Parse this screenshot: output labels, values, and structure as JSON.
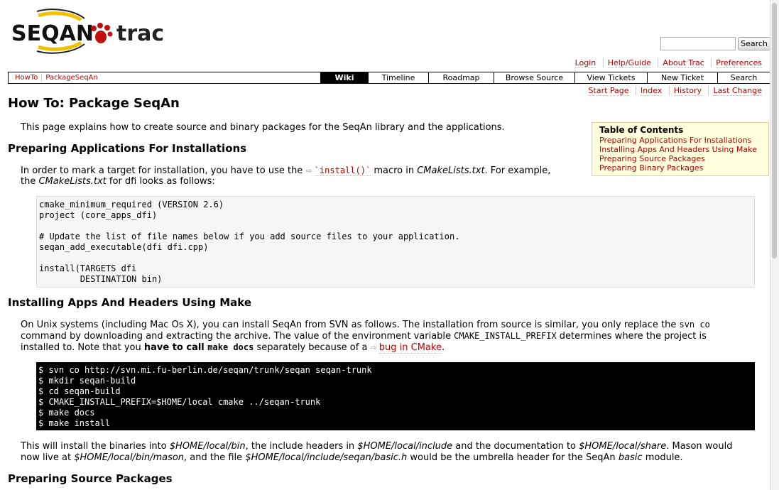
{
  "header": {
    "logo_text": "SEQAN trac",
    "search_button": "Search",
    "search_value": ""
  },
  "metanav": [
    "Login",
    "Help/Guide",
    "About Trac",
    "Preferences"
  ],
  "breadcrumbs": [
    "HowTo",
    "PackageSeqAn"
  ],
  "mainnav": [
    {
      "label": "Wiki",
      "active": true
    },
    {
      "label": "Timeline"
    },
    {
      "label": "Roadmap"
    },
    {
      "label": "Browse Source"
    },
    {
      "label": "View Tickets"
    },
    {
      "label": "New Ticket"
    },
    {
      "label": "Search"
    }
  ],
  "pagenav": [
    "Start Page",
    "Index",
    "History",
    "Last Change"
  ],
  "page": {
    "title": "How To: Package SeqAn",
    "intro": "This page explains how to create source and binary packages for the SeqAn library and the applications.",
    "section1": {
      "heading": "Preparing Applications For Installations",
      "p1_a": "In order to mark a target for installation, you have to use the ",
      "p1_link": "`install()`",
      "p1_b": " macro in ",
      "p1_file": "CMakeLists.txt",
      "p1_c": ". For example,",
      "p1_d": "the ",
      "p1_file2": "CMakeLists.txt",
      "p1_e": " for dfi looks as follows:",
      "code": "cmake_minimum_required (VERSION 2.6)\nproject (core_apps_dfi)\n\n# Update the list of file names below if you add source files to your application.\nseqan_add_executable(dfi dfi.cpp)\n\ninstall(TARGETS dfi\n        DESTINATION bin)"
    },
    "section2": {
      "heading": "Installing Apps And Headers Using Make",
      "p_a": "On Unix systems (including Mac Os X), you can install SeqAn from SVN as follows. The installation from source is similar, you only replace the ",
      "p_code1": "svn co",
      "p_b": "command by downloading and extracting the archive. The value of the environment variable ",
      "p_code2": "CMAKE_INSTALL_PREFIX",
      "p_c": " determines where the project is",
      "p_d": "installed to. Note that you ",
      "p_bold": "have to call ",
      "p_code3": "make docs",
      "p_e": " separately because of a ",
      "p_link": "bug in CMake",
      "p_f": ".",
      "shell": "$ svn co http://svn.mi.fu-berlin.de/seqan/trunk/seqan seqan-trunk\n$ mkdir seqan-build\n$ cd seqan-build\n$ CMAKE_INSTALL_PREFIX=$HOME/local cmake ../seqan-trunk\n$ make docs\n$ make install",
      "after_a": "This will install the binaries into ",
      "after_i1": "$HOME/local/bin",
      "after_b": ", the include headers in ",
      "after_i2": "$HOME/local/include",
      "after_c": " and the documentation to ",
      "after_i3": "$HOME/local/share",
      "after_d": ". Mason would",
      "after_e": "now live at ",
      "after_i4": "$HOME/local/bin/mason",
      "after_f": ", and the file ",
      "after_i5": "$HOME/local/include/seqan/basic.h",
      "after_g": " would be the umbrella header for the SeqAn ",
      "after_i6": "basic",
      "after_h": " module."
    },
    "section3": {
      "heading": "Preparing Source Packages"
    }
  },
  "toc": {
    "title": "Table of Contents",
    "items": [
      "Preparing Applications For Installations",
      "Installing Apps And Headers Using Make",
      "Preparing Source Packages",
      "Preparing Binary Packages"
    ]
  },
  "icons": {
    "external_link": "external-link-icon"
  },
  "colors": {
    "link": "#bb0000",
    "toc_bg": "#ffffdd",
    "logo_yellow": "#f2c200"
  }
}
